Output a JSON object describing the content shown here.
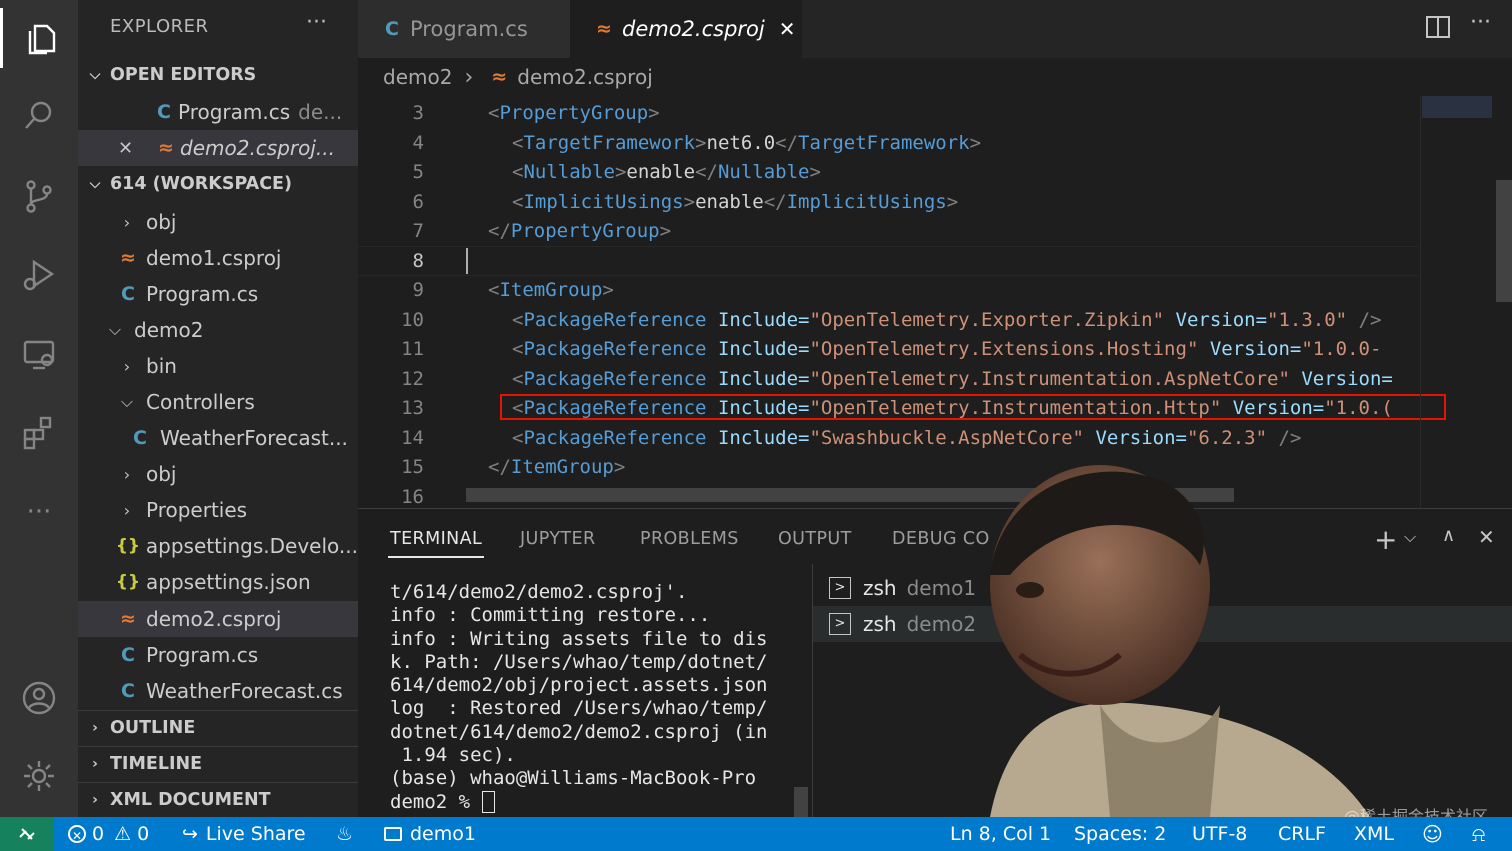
{
  "sidebar": {
    "title": "EXPLORER",
    "more_label": "···",
    "open_editors_header": "OPEN EDITORS",
    "open_editors": [
      {
        "name": "Program.cs",
        "desc": "de..."
      },
      {
        "name": "demo2.csproj..."
      }
    ],
    "workspace_header": "614 (WORKSPACE)",
    "tree": [
      {
        "label": "obj"
      },
      {
        "label": "demo1.csproj"
      },
      {
        "label": "Program.cs"
      },
      {
        "label": "demo2"
      },
      {
        "label": "bin"
      },
      {
        "label": "Controllers"
      },
      {
        "label": "WeatherForecast..."
      },
      {
        "label": "obj"
      },
      {
        "label": "Properties"
      },
      {
        "label": "appsettings.Develo..."
      },
      {
        "label": "appsettings.json"
      },
      {
        "label": "demo2.csproj"
      },
      {
        "label": "Program.cs"
      },
      {
        "label": "WeatherForecast.cs"
      }
    ],
    "outline": "OUTLINE",
    "timeline": "TIMELINE",
    "xml_document": "XML DOCUMENT"
  },
  "tabs": [
    {
      "label": "Program.cs"
    },
    {
      "label": "demo2.csproj"
    }
  ],
  "icons": {
    "cs": "C",
    "rss": "≈",
    "json": "{}",
    "close": "✕",
    "chevron_down": "⌵",
    "chevron_right": "›"
  },
  "breadcrumb": {
    "folder": "demo2",
    "file": "demo2.csproj"
  },
  "editor": {
    "line_numbers": [
      "3",
      "4",
      "5",
      "6",
      "7",
      "8",
      "9",
      "10",
      "11",
      "12",
      "13",
      "14",
      "15",
      "16"
    ],
    "lines": {
      "l3": {
        "tag": "PropertyGroup"
      },
      "l4": {
        "tag": "TargetFramework",
        "text": "net6.0"
      },
      "l5": {
        "tag": "Nullable",
        "text": "enable"
      },
      "l6": {
        "tag": "ImplicitUsings",
        "text": "enable"
      },
      "l7": {
        "tag": "PropertyGroup"
      },
      "l9": {
        "tag": "ItemGroup"
      },
      "l10": {
        "tag": "PackageReference",
        "include": "\"OpenTelemetry.Exporter.Zipkin\"",
        "version": "\"1.3.0\"",
        "end": "/>"
      },
      "l11": {
        "tag": "PackageReference",
        "include": "\"OpenTelemetry.Extensions.Hosting\"",
        "version": "\"1.0.0-"
      },
      "l12": {
        "tag": "PackageReference",
        "include": "\"OpenTelemetry.Instrumentation.AspNetCore\"",
        "version_attr": "Version="
      },
      "l13": {
        "tag": "PackageReference",
        "include": "\"OpenTelemetry.Instrumentation.Http\"",
        "version": "\"1.0.("
      },
      "l14": {
        "tag": "PackageReference",
        "include": "\"Swashbuckle.AspNetCore\"",
        "version": "\"6.2.3\"",
        "end": "/>"
      },
      "l15": {
        "tag": "ItemGroup"
      }
    },
    "attr_include": "Include=",
    "attr_version": "Version=",
    "highlight_color": "#e51400"
  },
  "panel": {
    "tabs": [
      "TERMINAL",
      "JUPYTER",
      "PROBLEMS",
      "OUTPUT",
      "DEBUG CO"
    ],
    "terminal_lines": [
      "t/614/demo2/demo2.csproj'.",
      "info : Committing restore...",
      "info : Writing assets file to dis",
      "k. Path: /Users/whao/temp/dotnet/",
      "614/demo2/obj/project.assets.json",
      "log  : Restored /Users/whao/temp/",
      "dotnet/614/demo2/demo2.csproj (in",
      " 1.94 sec).",
      "(base) whao@Williams-MacBook-Pro",
      "demo2 % "
    ],
    "terminals": [
      {
        "shell": "zsh",
        "name": "demo1"
      },
      {
        "shell": "zsh",
        "name": "demo2"
      }
    ]
  },
  "status": {
    "errors": "0",
    "warnings": "0",
    "live_share": "Live Share",
    "folder": "demo1",
    "position": "Ln 8, Col 1",
    "spaces": "Spaces: 2",
    "encoding": "UTF-8",
    "eol": "CRLF",
    "language": "XML",
    "accent": "#007acc"
  },
  "watermark": "@稀土掘金技术社区"
}
